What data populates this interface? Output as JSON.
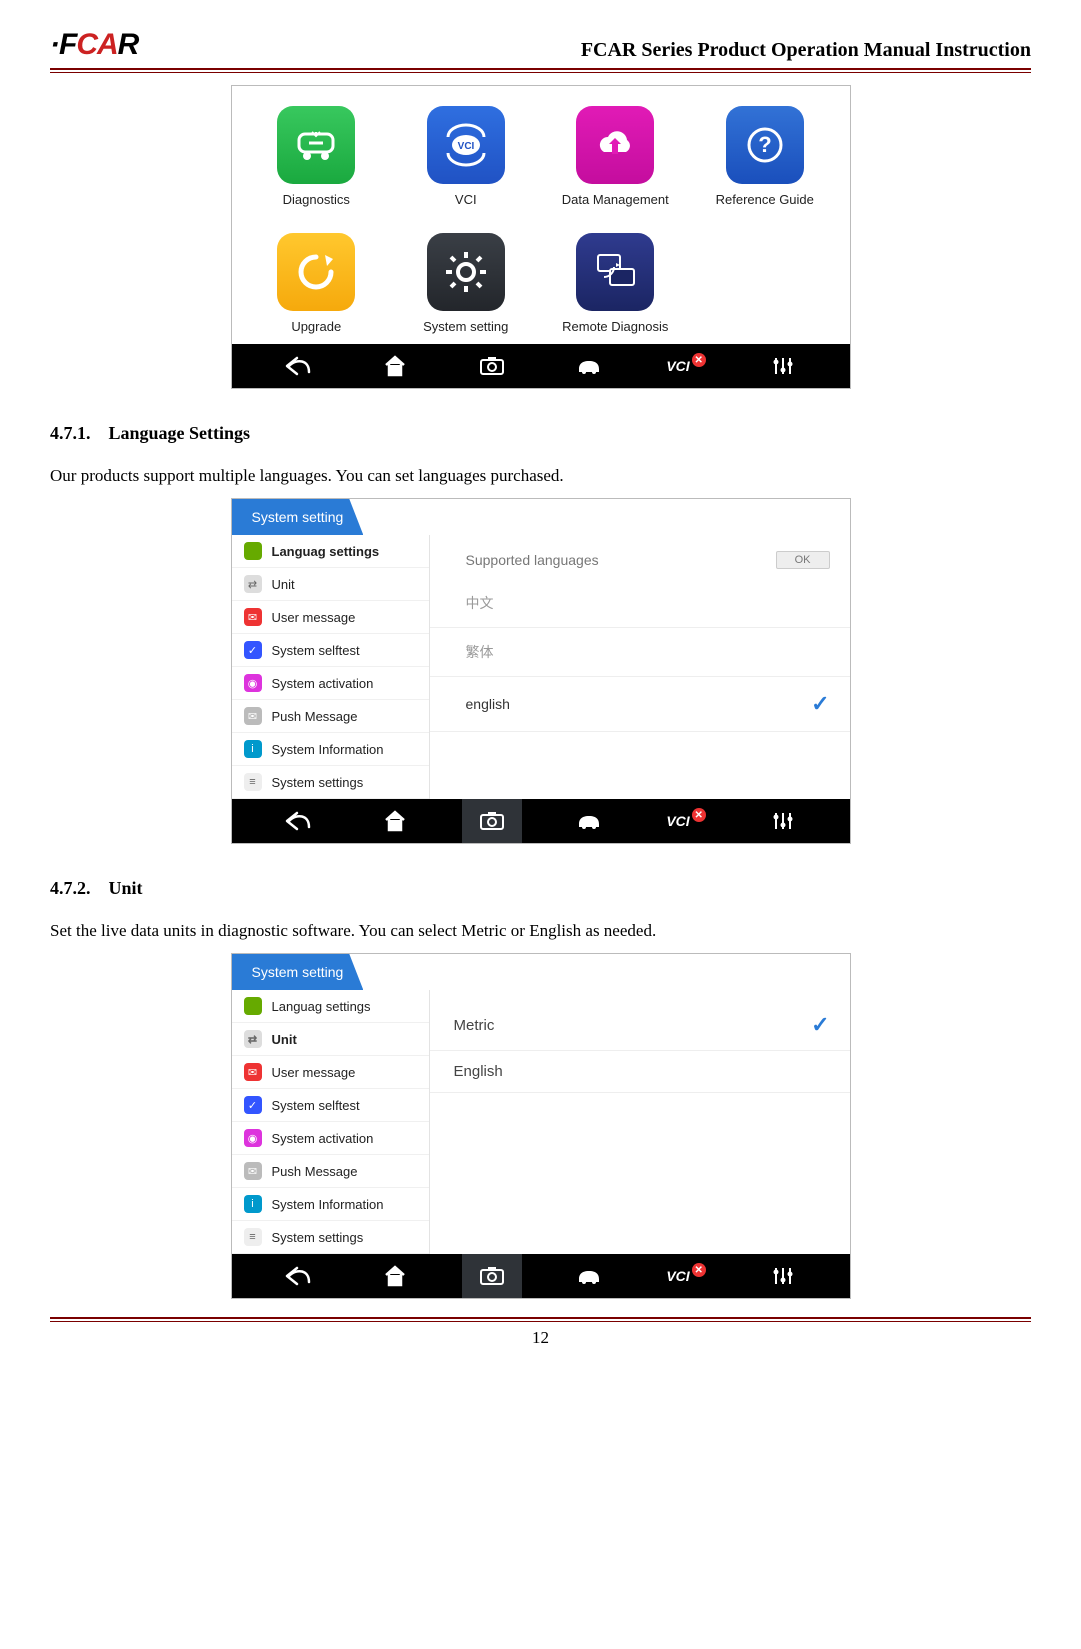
{
  "header": {
    "logo_f": "F",
    "logo_ca": "CA",
    "logo_r": "R",
    "title": "FCAR Series Product  Operation Manual Instruction"
  },
  "shot1": {
    "apps": [
      {
        "label": "Diagnostics"
      },
      {
        "label": "VCI",
        "vci_text": "VCI"
      },
      {
        "label": "Data Management"
      },
      {
        "label": "Reference Guide"
      },
      {
        "label": "Upgrade"
      },
      {
        "label": "System setting"
      },
      {
        "label": "Remote Diagnosis"
      }
    ],
    "vci_label": "VCI"
  },
  "section1": {
    "num": "4.7.1.",
    "title": "Language Settings"
  },
  "para1": "Our products support multiple languages. You can set languages purchased.",
  "shot2": {
    "tab": "System setting",
    "side": [
      "Languag settings",
      "Unit",
      "User message",
      "System selftest",
      "System activation",
      "Push Message",
      "System Information",
      "System settings"
    ],
    "content_title": "Supported languages",
    "ok": "OK",
    "rows": [
      "中文",
      "繁体",
      "english"
    ]
  },
  "section2": {
    "num": "4.7.2.",
    "title": "Unit"
  },
  "para2": "Set the live data units in diagnostic software. You can select Metric or English as needed.",
  "shot3": {
    "tab": "System setting",
    "side": [
      "Languag settings",
      "Unit",
      "User message",
      "System selftest",
      "System activation",
      "Push Message",
      "System Information",
      "System settings"
    ],
    "rows": [
      "Metric",
      "English"
    ]
  },
  "page_number": "12"
}
